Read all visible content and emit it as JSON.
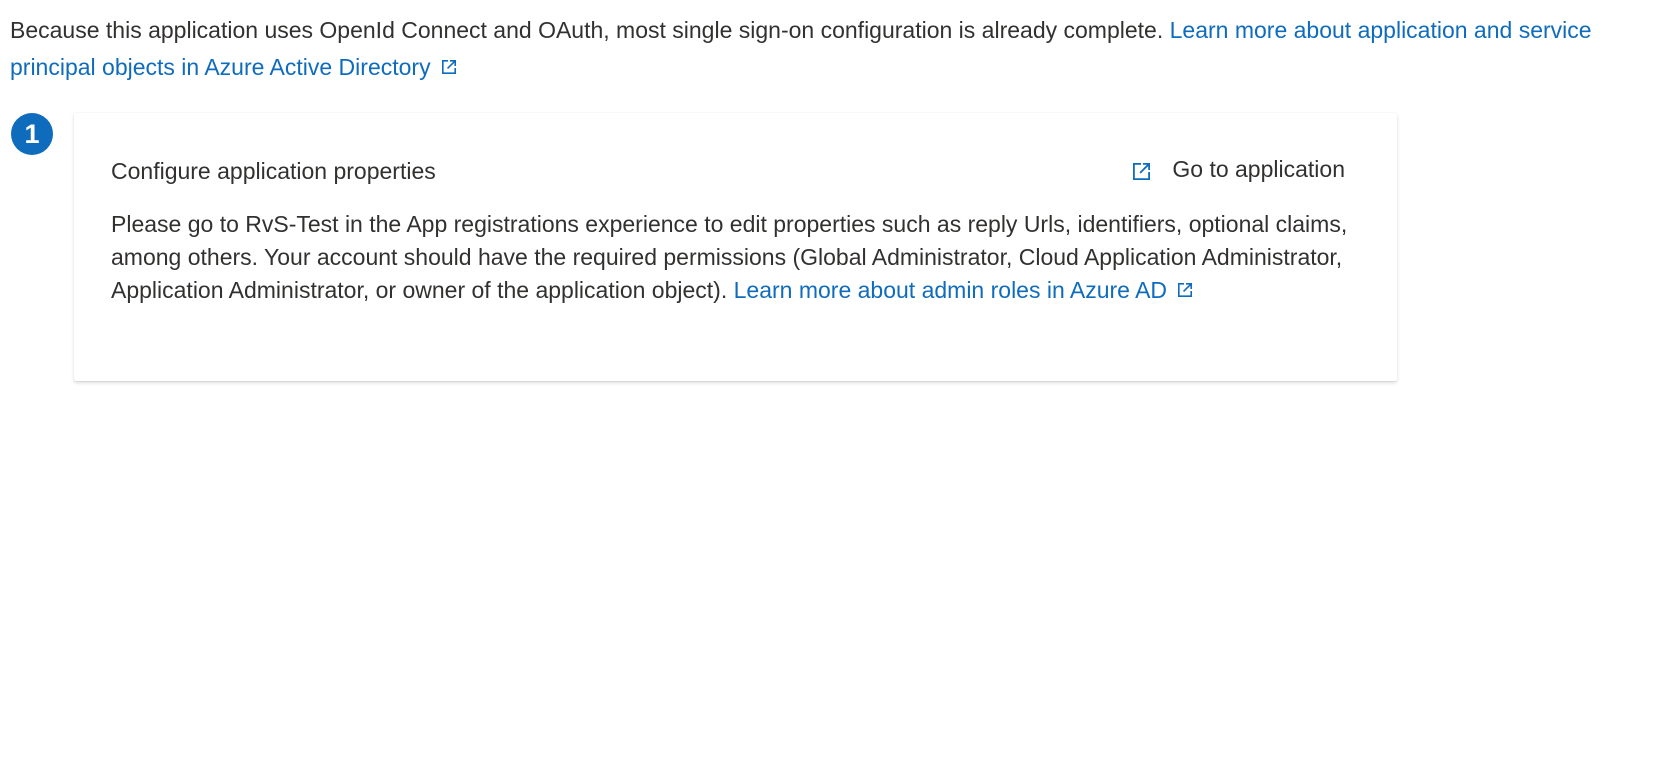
{
  "intro": {
    "text": "Because this application uses OpenId Connect and OAuth, most single sign-on configuration is already complete. ",
    "link_text": "Learn more about application and service principal objects in Azure Active Directory"
  },
  "step": {
    "number": "1",
    "title": "Configure application properties",
    "goto_label": "Go to application",
    "body_text": "Please go to RvS-Test in the App registrations experience to edit properties such as reply Urls, identifiers, optional claims, among others. Your account should have the required permissions (Global Administrator, Cloud Application Administrator, Application Administrator, or owner of the application object). ",
    "link_text": "Learn more about admin roles in Azure AD"
  },
  "colors": {
    "accent": "#0f6cbd",
    "text": "#323130"
  },
  "icons": {
    "external_link": "open-in-new-icon"
  }
}
